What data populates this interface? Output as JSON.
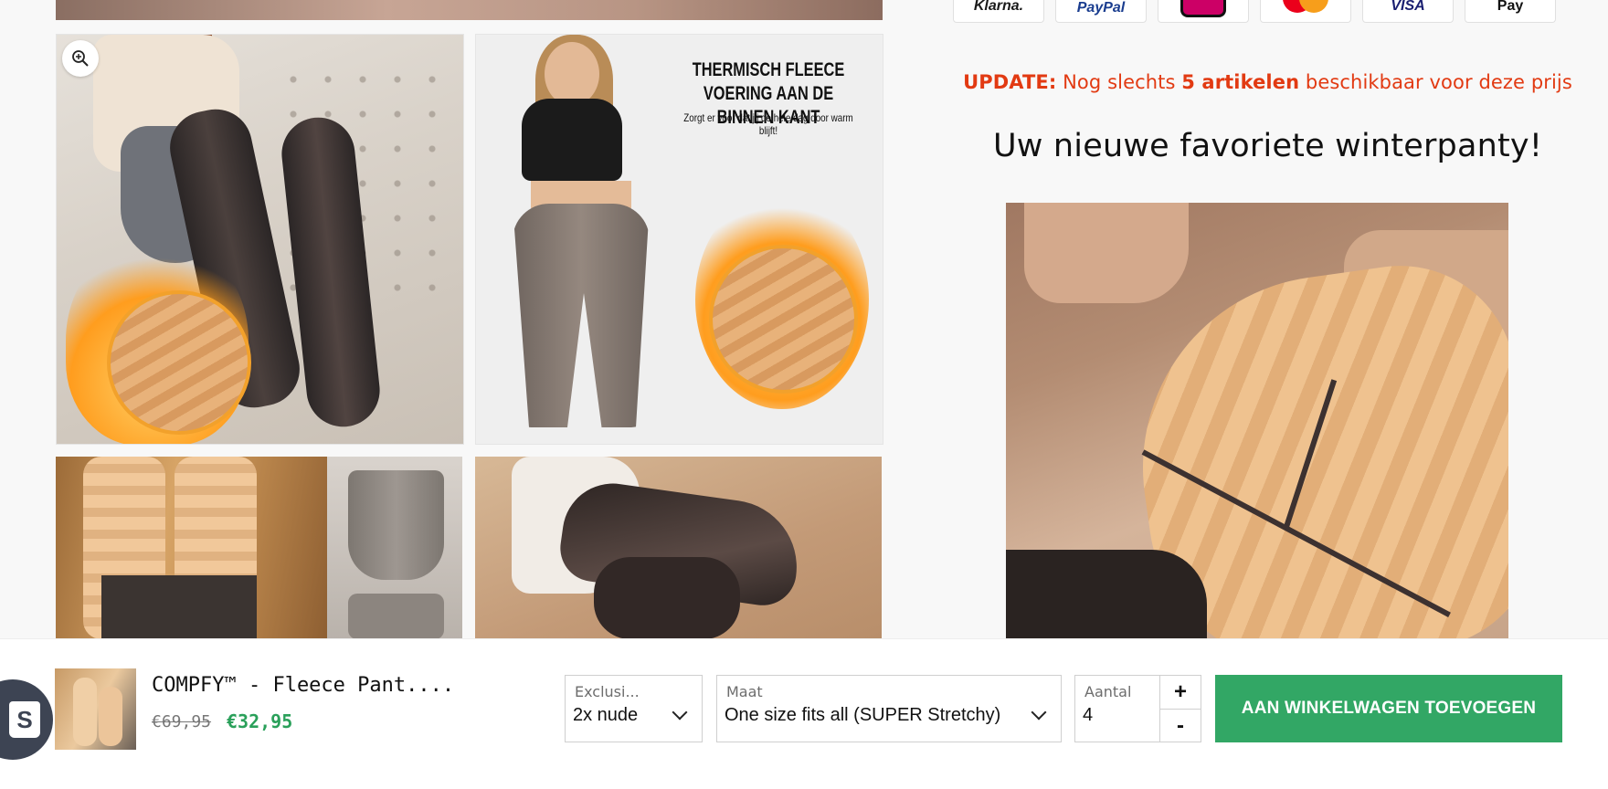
{
  "gallery": {
    "thermal_title": "Thermisch fleece voering aan de binnen kant",
    "thermal_subtitle": "Zorgt er voor dat jij de hele dag door warm blijft!"
  },
  "payment_methods": [
    "Klarna",
    "PayPal",
    "iDEAL",
    "Mastercard",
    "Visa",
    "Apple Pay"
  ],
  "payment_labels": {
    "klarna": "Klarna.",
    "paypal": "PayPal",
    "visa": "VISA",
    "apple": "Pay"
  },
  "stock_notice": {
    "prefix": "UPDATE:",
    "before": "Nog slechts",
    "count": "5 artikelen",
    "after": "beschikbaar voor deze prijs"
  },
  "headline": "Uw nieuwe favoriete winterpanty!",
  "sticky_bar": {
    "title": "COMPFY™ - Fleece Pant....",
    "old_price": "€69,95",
    "new_price": "€32,95",
    "option1": {
      "label": "Exclusi...",
      "value": "2x nude"
    },
    "option2": {
      "label": "Maat",
      "value": "One size fits all (SUPER Stretchy)"
    },
    "quantity": {
      "label": "Aantal",
      "value": "4",
      "plus": "+",
      "minus": "-"
    },
    "add_to_cart": "AAN WINKELWAGEN TOEVOEGEN"
  },
  "colors": {
    "accent_red": "#e23a12",
    "cta_green": "#32a765",
    "price_green": "#2aa05a"
  }
}
